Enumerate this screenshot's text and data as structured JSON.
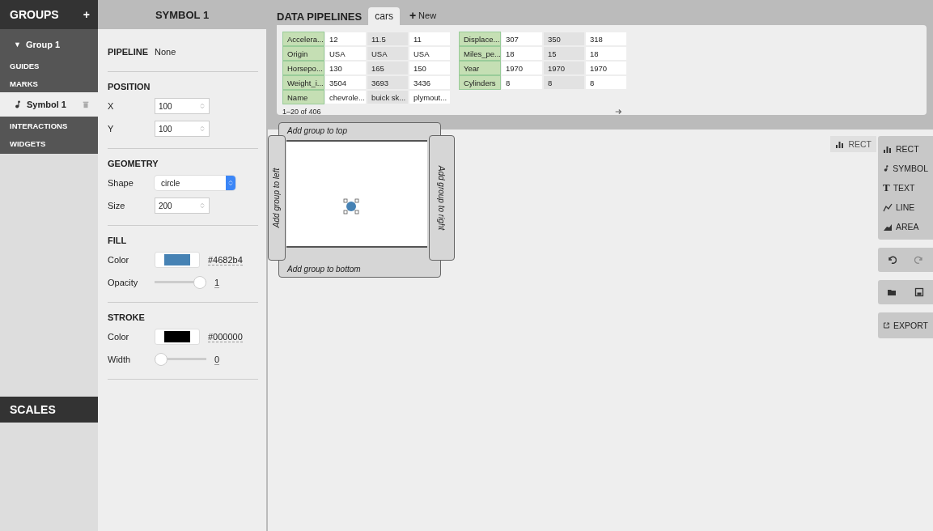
{
  "sidebar": {
    "title": "GROUPS",
    "add": "+",
    "items": [
      {
        "label": "Group 1",
        "kind": "group",
        "expanded": true,
        "caret": "▼",
        "selected": false
      },
      {
        "label": "GUIDES",
        "kind": "section",
        "selected": false
      },
      {
        "label": "MARKS",
        "kind": "section",
        "selected": false
      },
      {
        "label": "Symbol 1",
        "kind": "mark",
        "selected": true
      },
      {
        "label": "INTERACTIONS",
        "kind": "section",
        "selected": false
      },
      {
        "label": "WIDGETS",
        "kind": "section",
        "selected": false
      }
    ],
    "scales_title": "SCALES"
  },
  "inspector": {
    "title": "SYMBOL 1",
    "pipeline_label": "PIPELINE",
    "pipeline_value": "None",
    "sections": [
      {
        "title": "POSITION",
        "props": [
          {
            "label": "X",
            "kind": "number",
            "value": "100"
          },
          {
            "label": "Y",
            "kind": "number",
            "value": "100"
          }
        ]
      },
      {
        "title": "GEOMETRY",
        "props": [
          {
            "label": "Shape",
            "kind": "select",
            "value": "circle"
          },
          {
            "label": "Size",
            "kind": "number",
            "value": "200"
          }
        ]
      },
      {
        "title": "FILL",
        "props": [
          {
            "label": "Color",
            "kind": "color",
            "value": "#4682b4",
            "color": "#4682b4"
          },
          {
            "label": "Opacity",
            "kind": "slider",
            "value": "1",
            "level": 1
          }
        ]
      },
      {
        "title": "STROKE",
        "props": [
          {
            "label": "Color",
            "kind": "color",
            "value": "#000000",
            "color": "#000000"
          },
          {
            "label": "Width",
            "kind": "slider",
            "value": "0",
            "level": 0
          }
        ]
      }
    ]
  },
  "pipelines": {
    "title": "DATA PIPELINES",
    "tabs": [
      {
        "label": "cars",
        "selected": true
      }
    ],
    "new_icon": "+",
    "new_label": "New",
    "tables": [
      [
        {
          "field": "Accelera...",
          "values": [
            "12",
            "11.5",
            "11"
          ]
        },
        {
          "field": "Origin",
          "values": [
            "USA",
            "USA",
            "USA"
          ]
        },
        {
          "field": "Horsepo...",
          "values": [
            "130",
            "165",
            "150"
          ]
        },
        {
          "field": "Weight_i...",
          "values": [
            "3504",
            "3693",
            "3436"
          ]
        },
        {
          "field": "Name",
          "values": [
            "chevrole...",
            "buick sk...",
            "plymout..."
          ]
        }
      ],
      [
        {
          "field": "Displace...",
          "values": [
            "307",
            "350",
            "318"
          ]
        },
        {
          "field": "Miles_pe...",
          "values": [
            "18",
            "15",
            "18"
          ]
        },
        {
          "field": "Year",
          "values": [
            "1970",
            "1970",
            "1970"
          ]
        },
        {
          "field": "Cylinders",
          "values": [
            "8",
            "8",
            "8"
          ]
        }
      ]
    ],
    "paging": "1–20 of 406"
  },
  "canvas": {
    "top": "Add group to top",
    "left": "Add group to left",
    "right": "Add group to right",
    "bottom": "Add group to bottom"
  },
  "toolbar": {
    "marks": [
      {
        "kind": "rect",
        "label": "RECT"
      },
      {
        "kind": "symbol",
        "label": "SYMBOL"
      },
      {
        "kind": "text",
        "label": "TEXT",
        "icon_text": "T"
      },
      {
        "kind": "line",
        "label": "LINE"
      },
      {
        "kind": "area",
        "label": "AREA"
      }
    ],
    "drag_ghost": {
      "kind": "rect",
      "label": "RECT"
    },
    "export": "EXPORT"
  }
}
